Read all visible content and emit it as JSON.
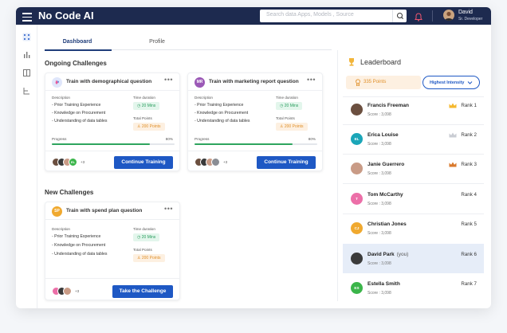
{
  "header": {
    "app_title": "No Code AI",
    "search_placeholder": "Search data Apps, Models , Source",
    "user": {
      "name": "David",
      "role": "Sr. Developer"
    }
  },
  "tabs": [
    {
      "label": "Dashboard",
      "active": true
    },
    {
      "label": "Profile",
      "active": false
    }
  ],
  "sidebar": {
    "icons": [
      "apps-grid-icon",
      "bar-chart-icon",
      "book-icon",
      "hierarchy-icon"
    ]
  },
  "ongoing": {
    "title": "Ongoing Challenges",
    "cards": [
      {
        "badge": "",
        "badge_color": "#dfe6fb",
        "title": "Train with demographical question",
        "description_label": "Description",
        "items": [
          "- Prior Training Experience",
          "- Knowledge on Procurement",
          "- Understanding of data tables"
        ],
        "time_label": "Time duration",
        "time_value": "20 Mins",
        "points_label": "Total Points",
        "points_value": "200 Points",
        "progress_label": "Progress",
        "progress_percent": "80%",
        "progress": 0.8,
        "avatar_badge": "EL",
        "more": "+3",
        "button": "Continue Training"
      },
      {
        "badge": "MR",
        "badge_color": "#9b59b6",
        "title": "Train with marketing report question",
        "description_label": "Description",
        "items": [
          "- Prior Training Experience",
          "- Knowledge on Procurement",
          "- Understanding of data tables"
        ],
        "time_label": "Time duration",
        "time_value": "20 Mins",
        "points_label": "Total Points",
        "points_value": "200 Points",
        "progress_label": "Progress",
        "progress_percent": "80%",
        "progress": 0.8,
        "avatar_badge": "",
        "more": "+3",
        "button": "Continue Training"
      }
    ]
  },
  "new": {
    "title": "New Challenges",
    "cards": [
      {
        "badge": "SP",
        "badge_color": "#f0a92f",
        "title": "Train with spend plan question",
        "description_label": "Description",
        "items": [
          "- Prior Training Experience",
          "- Knowledge on Procurement",
          "- Understanding of data tables"
        ],
        "time_label": "Time duration",
        "time_value": "20 Mins",
        "points_label": "Total Points",
        "points_value": "200 Points",
        "more": "+3",
        "button": "Take the Challenge"
      }
    ]
  },
  "leaderboard": {
    "title": "Leaderboard",
    "points": "335 Points",
    "filter": "Highest Intensity",
    "rows": [
      {
        "name": "Francis Freeman",
        "you": "",
        "score": "Score : 3,098",
        "rank": "Rank 1",
        "initials": "",
        "color": "#6b4f3f",
        "crown": "#f5b82e"
      },
      {
        "name": "Erica Louise",
        "you": "",
        "score": "Score : 3,098",
        "rank": "Rank 2",
        "initials": "EL",
        "color": "#1ba6b8",
        "crown": "#c9ccd3"
      },
      {
        "name": "Janie Guerrero",
        "you": "",
        "score": "Score : 3,098",
        "rank": "Rank 3",
        "initials": "",
        "color": "#c99b86",
        "crown": "#d9792c"
      },
      {
        "name": "Tom McCarthy",
        "you": "",
        "score": "Score : 3,098",
        "rank": "Rank 4",
        "initials": "T",
        "color": "#ec6fa8",
        "crown": ""
      },
      {
        "name": "Christian Jones",
        "you": "",
        "score": "Score : 3,098",
        "rank": "Rank 5",
        "initials": "CJ",
        "color": "#f0a92f",
        "crown": ""
      },
      {
        "name": "David Park",
        "you": "(you)",
        "score": "Score : 3,098",
        "rank": "Rank 6",
        "initials": "",
        "color": "#3b3b3b",
        "crown": ""
      },
      {
        "name": "Estella Smith",
        "you": "",
        "score": "Score : 3,098",
        "rank": "Rank 7",
        "initials": "ES",
        "color": "#3bb54a",
        "crown": ""
      }
    ]
  }
}
